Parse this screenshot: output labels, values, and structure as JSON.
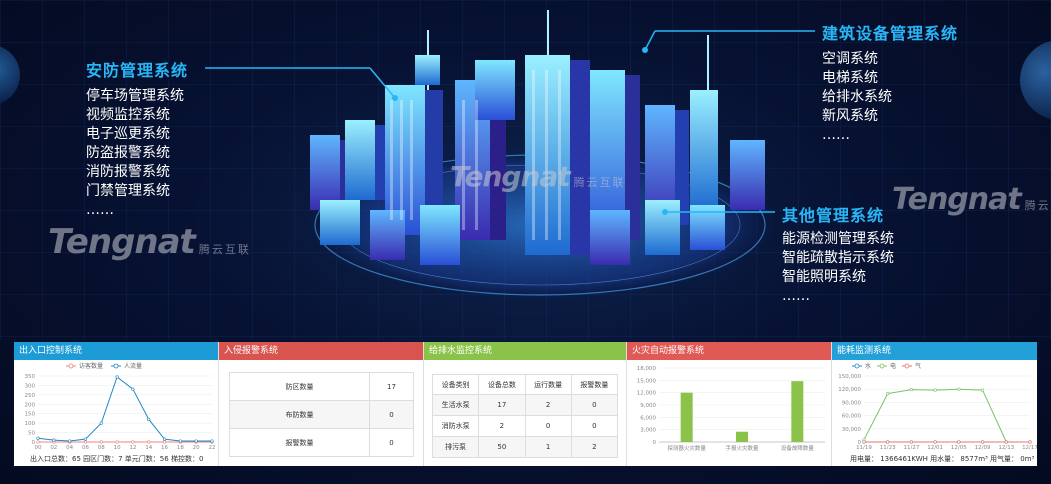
{
  "watermark": {
    "brand": "Tengnat",
    "cn": "腾云互联"
  },
  "security": {
    "title": "安防管理系统",
    "items": [
      "停车场管理系统",
      "视频监控系统",
      "电子巡更系统",
      "防盗报警系统",
      "消防报警系统",
      "门禁管理系统",
      "……"
    ]
  },
  "building": {
    "title": "建筑设备管理系统",
    "items": [
      "空调系统",
      "电梯系统",
      "给排水系统",
      "新风系统",
      "……"
    ]
  },
  "other": {
    "title": "其他管理系统",
    "items": [
      "能源检测管理系统",
      "智能疏散指示系统",
      "智能照明系统",
      "……"
    ]
  },
  "panels": {
    "access": {
      "title": "出入口控制系统",
      "legend": [
        "访客数量",
        "人流量"
      ],
      "footer": "出入口总数：65   园区门数：7   单元门数：56   梯控数：0"
    },
    "intrusion": {
      "title": "入侵报警系统",
      "rows": [
        {
          "label": "防区数量",
          "value": "17"
        },
        {
          "label": "布防数量",
          "value": "0"
        },
        {
          "label": "报警数量",
          "value": "0"
        }
      ]
    },
    "water": {
      "title": "给排水监控系统",
      "headers": [
        "设备类别",
        "设备总数",
        "运行数量",
        "报警数量"
      ],
      "rows": [
        [
          "生活水泵",
          "17",
          "2",
          "0"
        ],
        [
          "消防水泵",
          "2",
          "0",
          "0"
        ],
        [
          "排污泵",
          "50",
          "1",
          "2"
        ]
      ]
    },
    "fire": {
      "title": "火灾自动报警系统"
    },
    "energy": {
      "title": "能耗监测系统",
      "legend": [
        "水",
        "电",
        "气"
      ],
      "footer": "用电量：  1366461KWH    用水量：  8577m³    用气量：  0m³"
    }
  },
  "chart_data": [
    {
      "type": "line",
      "x": [
        "00",
        "02",
        "04",
        "06",
        "08",
        "10",
        "12",
        "14",
        "16",
        "18",
        "20",
        "22"
      ],
      "series": [
        {
          "name": "访客数量",
          "values": [
            0,
            0,
            0,
            0,
            0,
            0,
            0,
            0,
            0,
            0,
            0,
            0
          ]
        },
        {
          "name": "人流量",
          "values": [
            20,
            10,
            5,
            15,
            100,
            345,
            280,
            120,
            15,
            5,
            5,
            5
          ]
        }
      ],
      "ylim": [
        0,
        350
      ],
      "yticks": [
        0,
        50,
        100,
        150,
        200,
        250,
        300,
        350
      ],
      "colors": [
        "#f08080",
        "#1e88c8"
      ]
    },
    {
      "type": "bar",
      "categories": [
        "探测器火灾数量",
        "手报火灾数量",
        "设备故障数量"
      ],
      "values": [
        12000,
        2500,
        14800
      ],
      "ylim": [
        0,
        18000
      ],
      "yticks": [
        0,
        3000,
        6000,
        9000,
        12000,
        15000,
        18000
      ],
      "color": "#8bc34a"
    },
    {
      "type": "line",
      "x": [
        "11/19",
        "11/23",
        "11/27",
        "12/01",
        "12/05",
        "12/09",
        "12/13",
        "12/17"
      ],
      "series": [
        {
          "name": "水",
          "values": [
            0,
            0,
            0,
            0,
            0,
            0,
            0,
            0
          ]
        },
        {
          "name": "电",
          "values": [
            5000,
            110000,
            119000,
            118000,
            120000,
            118000,
            0,
            0
          ]
        },
        {
          "name": "气",
          "values": [
            0,
            0,
            0,
            0,
            0,
            0,
            0,
            0
          ]
        }
      ],
      "ylim": [
        0,
        150000
      ],
      "yticks": [
        0,
        30000,
        60000,
        90000,
        120000,
        150000
      ],
      "colors": [
        "#1e88c8",
        "#7cc06a",
        "#e57373"
      ]
    }
  ]
}
